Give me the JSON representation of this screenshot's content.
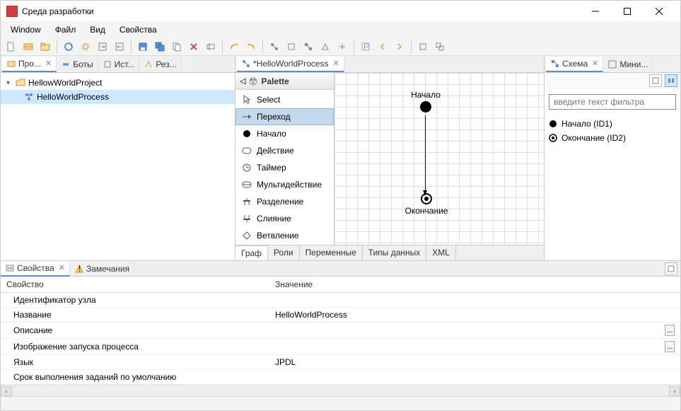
{
  "window": {
    "title": "Среда разработки"
  },
  "menu": {
    "items": [
      "Window",
      "Файл",
      "Вид",
      "Свойства"
    ]
  },
  "left": {
    "tabs": [
      {
        "label": "Про...",
        "active": true
      },
      {
        "label": "Боты"
      },
      {
        "label": "Ист..."
      },
      {
        "label": "Рез..."
      }
    ],
    "projectName": "HellowWorldProject",
    "processName": "HelloWorldProcess"
  },
  "editor": {
    "tabLabel": "*HelloWorldProcess",
    "palette": {
      "header": "Palette",
      "items": [
        "Select",
        "Переход",
        "Начало",
        "Действие",
        "Таймер",
        "Мультидействие",
        "Разделение",
        "Слияние",
        "Ветвление"
      ],
      "selectedIndex": 1
    },
    "graph": {
      "startLabel": "Начало",
      "endLabel": "Окончание"
    },
    "bottomTabs": [
      "Граф",
      "Роли",
      "Переменные",
      "Типы данных",
      "XML"
    ]
  },
  "right": {
    "tabs": [
      {
        "label": "Схема",
        "active": true
      },
      {
        "label": "Мини..."
      }
    ],
    "filterPlaceholder": "введите текст фильтра",
    "outline": [
      {
        "icon": "start",
        "label": "Начало (ID1)"
      },
      {
        "icon": "end",
        "label": "Окончание (ID2)"
      }
    ]
  },
  "bottom": {
    "tabs": [
      {
        "label": "Свойства",
        "active": true
      },
      {
        "label": "Замечания"
      }
    ],
    "headers": {
      "name": "Свойство",
      "value": "Значение"
    },
    "rows": [
      {
        "name": "Идентификатор узла",
        "value": "",
        "btn": false
      },
      {
        "name": "Название",
        "value": "HelloWorldProcess",
        "btn": false
      },
      {
        "name": "Описание",
        "value": "",
        "btn": true
      },
      {
        "name": "Изображение запуска процесса",
        "value": "",
        "btn": true
      },
      {
        "name": "Язык",
        "value": "JPDL",
        "btn": false
      },
      {
        "name": "Срок выполнения заданий по умолчанию",
        "value": "",
        "btn": false
      }
    ]
  },
  "colors": {
    "selection": "#cde8ff",
    "paletteSel": "#c5d9ed"
  }
}
